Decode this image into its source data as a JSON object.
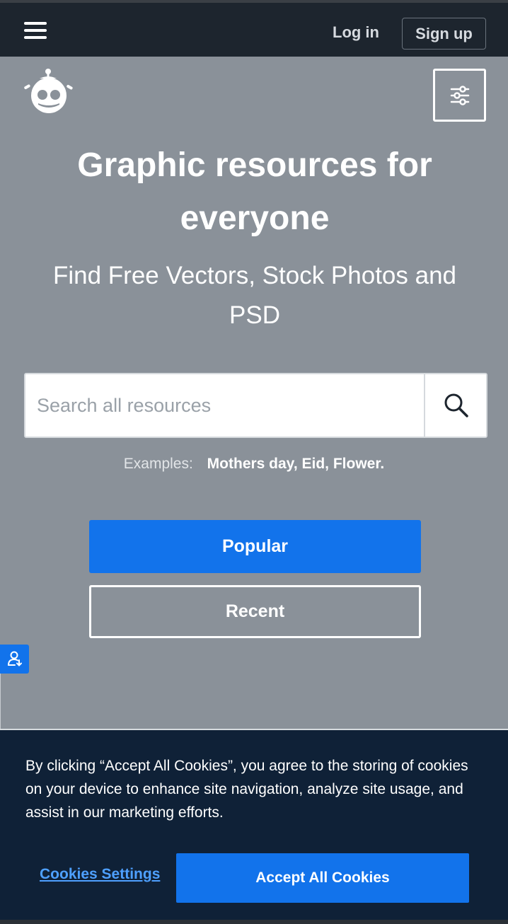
{
  "header": {
    "menu_icon": "hamburger-menu-icon",
    "login_label": "Log in",
    "signup_label": "Sign up"
  },
  "logo": {
    "icon": "freepik-robot-logo"
  },
  "filter": {
    "icon": "sliders-filter-icon"
  },
  "hero": {
    "title": "Graphic resources for everyone",
    "subtitle": "Find Free Vectors, Stock Photos and PSD"
  },
  "search": {
    "placeholder": "Search all resources",
    "value": "",
    "button_icon": "search-icon"
  },
  "examples": {
    "label": "Examples:",
    "items": [
      "Mothers day",
      "Eid",
      "Flower"
    ]
  },
  "buttons": {
    "popular": "Popular",
    "recent": "Recent"
  },
  "side_tab": {
    "icon": "user-download-icon"
  },
  "cookie_banner": {
    "text": "By clicking “Accept All Cookies”, you agree to the storing of cookies on your device to enhance site navigation, analyze site usage, and assist in our marketing efforts.",
    "settings_label": "Cookies Settings",
    "accept_label": "Accept All Cookies"
  },
  "colors": {
    "topbar": "#1d252e",
    "background": "#8a9199",
    "accent_blue": "#1273eb",
    "cookie_bg": "#0f2137",
    "cookie_link": "#4ea0ff"
  }
}
